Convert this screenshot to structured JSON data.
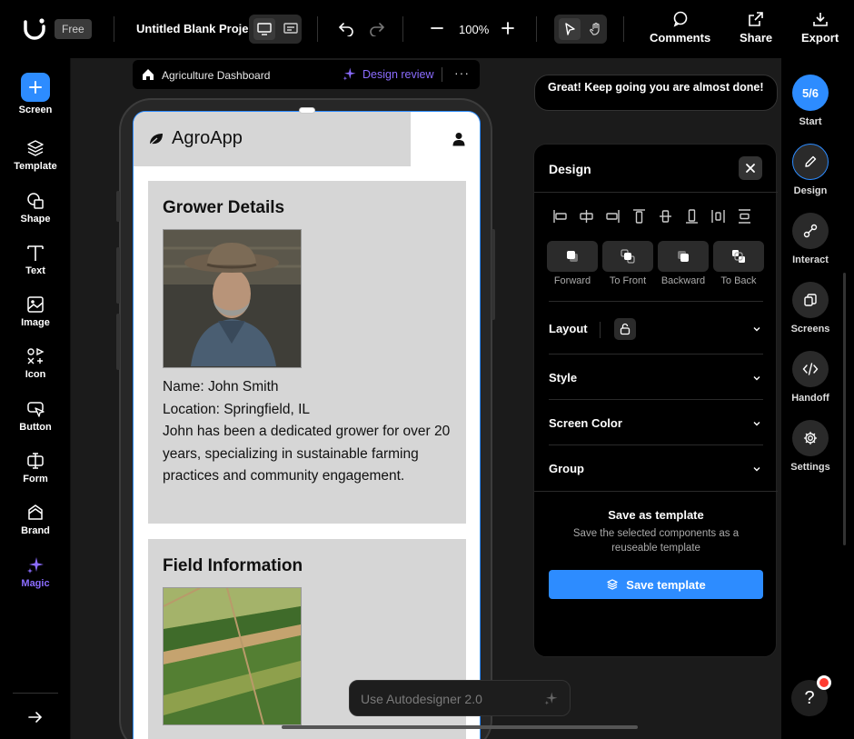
{
  "topbar": {
    "plan_badge": "Free",
    "project_title": "Untitled Blank Project",
    "zoom": "100%",
    "actions": [
      {
        "label": "Comments",
        "icon": "comment-icon"
      },
      {
        "label": "Share",
        "icon": "share-icon"
      },
      {
        "label": "Export",
        "icon": "download-icon"
      }
    ]
  },
  "leftbar": {
    "items": [
      {
        "label": "Screen",
        "icon": "plus-icon"
      },
      {
        "label": "Template",
        "icon": "layers-icon"
      },
      {
        "label": "Shape",
        "icon": "shape-icon"
      },
      {
        "label": "Text",
        "icon": "text-icon"
      },
      {
        "label": "Image",
        "icon": "image-icon"
      },
      {
        "label": "Icon",
        "icon": "icon-icon"
      },
      {
        "label": "Button",
        "icon": "button-icon"
      },
      {
        "label": "Form",
        "icon": "form-icon"
      },
      {
        "label": "Brand",
        "icon": "brand-icon"
      },
      {
        "label": "Magic",
        "icon": "magic-icon"
      }
    ]
  },
  "canvas_toolbar": {
    "screen_name": "Agriculture Dashboard",
    "review_label": "Design review",
    "more": "···"
  },
  "app": {
    "name": "AgroApp",
    "grower": {
      "heading": "Grower Details",
      "name_line": "Name: John Smith",
      "location_line": "Location: Springfield, IL",
      "bio": "John has been a dedicated grower for over 20 years, specializing in sustainable farming practices and community engagement."
    },
    "field": {
      "heading": "Field Information"
    }
  },
  "assistant": {
    "message": "Great! Keep going you are almost done!"
  },
  "design_panel": {
    "title": "Design",
    "arrange": [
      "Forward",
      "To Front",
      "Backward",
      "To Back"
    ],
    "sections": [
      "Layout",
      "Style",
      "Screen Color",
      "Group"
    ],
    "save_title": "Save as template",
    "save_desc": "Save the selected components as a reuseable template",
    "save_button": "Save template"
  },
  "rightbar": {
    "progress": "5/6",
    "items": [
      "Start",
      "Design",
      "Interact",
      "Screens",
      "Handoff",
      "Settings"
    ]
  },
  "autodesigner": {
    "placeholder": "Use Autodesigner 2.0"
  },
  "help": {
    "label": "?"
  },
  "colors": {
    "accent": "#2d8cff",
    "magic": "#8b6cff",
    "notification": "#ff3b30"
  }
}
